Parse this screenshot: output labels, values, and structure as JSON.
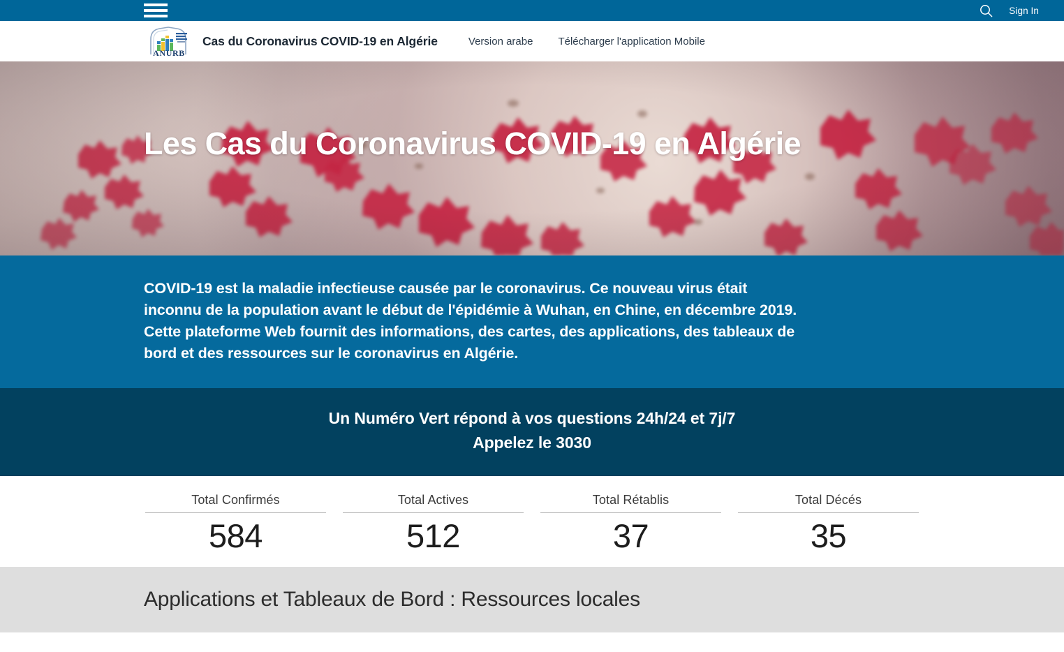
{
  "topbar": {
    "menu_icon": "hamburger-icon",
    "search_icon": "search-icon",
    "signin_label": "Sign In"
  },
  "navbar": {
    "logo_alt": "ANURB",
    "logo_text": "ANURB",
    "brand_title": "Cas du Coronavirus COVID-19 en Algérie",
    "links": [
      {
        "label": "Version arabe"
      },
      {
        "label": "Télécharger l'application Mobile"
      }
    ]
  },
  "hero": {
    "title": "Les Cas du Coronavirus COVID-19 en Algérie",
    "background_image": "coronavirus-microscopy-photo"
  },
  "info": {
    "paragraph_1": "COVID-19 est la maladie infectieuse causée par le coronavirus. Ce nouveau virus était inconnu de la population avant le début de l'épidémie à Wuhan, en Chine, en décembre 2019.",
    "paragraph_2": "Cette plateforme Web fournit des informations, des cartes, des applications, des tableaux de bord et des ressources sur le coronavirus en Algérie."
  },
  "hotline": {
    "line_1": "Un Numéro Vert répond à vos questions 24h/24 et 7j/7",
    "line_2": "Appelez le 3030"
  },
  "stats": [
    {
      "label": "Total Confirmés",
      "value": "584"
    },
    {
      "label": "Total Actives",
      "value": "512"
    },
    {
      "label": "Total Rétablis",
      "value": "37"
    },
    {
      "label": "Total Décés",
      "value": "35"
    }
  ],
  "section": {
    "title": "Applications et Tableaux de Bord : Ressources locales"
  },
  "colors": {
    "topbar_blue": "#006699",
    "info_blue": "#056a9d",
    "hotline_navy": "#02415f",
    "section_gray": "#dedede",
    "text_dark": "#1d1d1d"
  }
}
